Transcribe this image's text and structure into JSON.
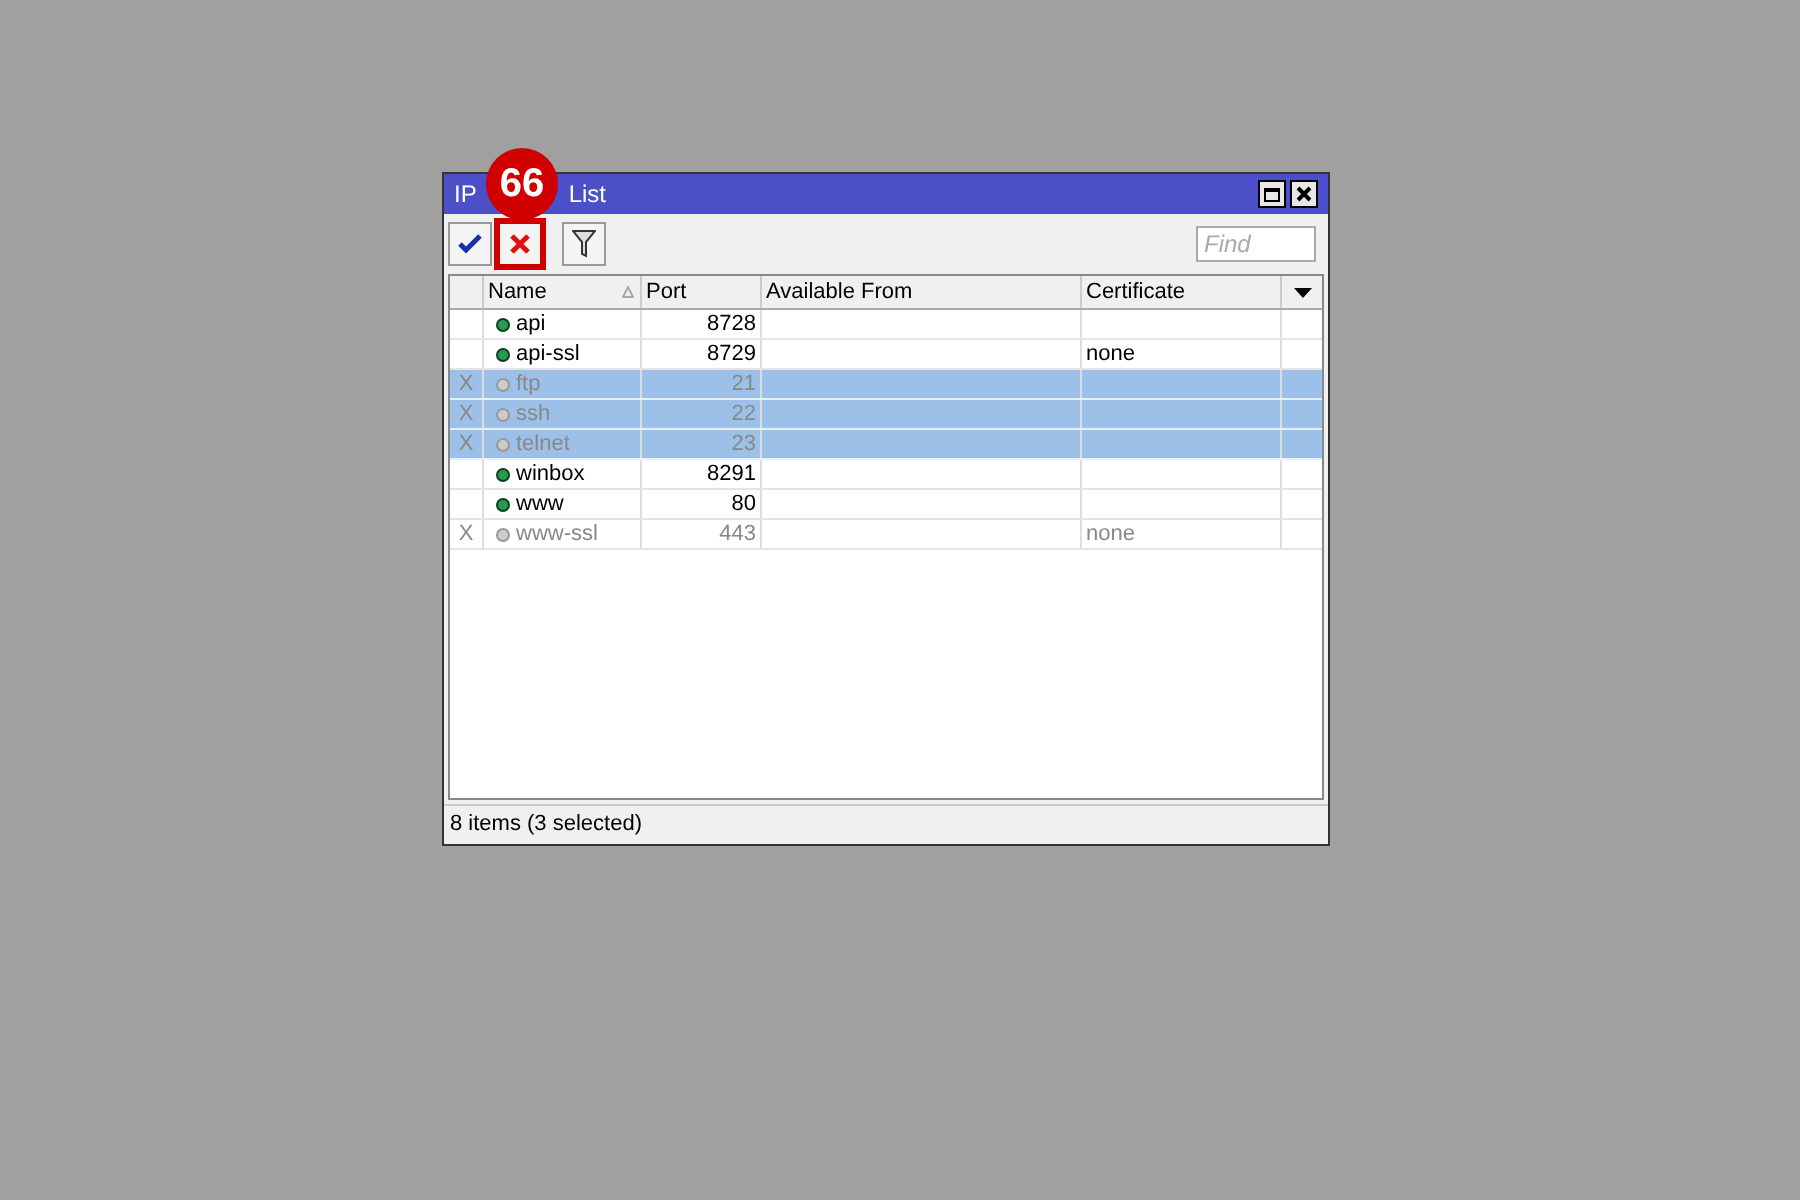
{
  "window": {
    "title_start": "IP",
    "title_end": "List"
  },
  "badge": {
    "text": "66"
  },
  "toolbar": {
    "buttons": [
      {
        "kind": "enable",
        "highlighted": false
      },
      {
        "kind": "disable",
        "highlighted": true
      },
      {
        "kind": "filter",
        "highlighted": false
      }
    ],
    "search": {
      "placeholder": "Find"
    }
  },
  "table": {
    "columns": [
      "Name",
      "Port",
      "Available From",
      "Certificate"
    ],
    "rows": [
      {
        "flag": "",
        "name": "api",
        "port": "8728",
        "available_from": "",
        "certificate": "",
        "disabled": false,
        "selected": false
      },
      {
        "flag": "",
        "name": "api-ssl",
        "port": "8729",
        "available_from": "",
        "certificate": "none",
        "disabled": false,
        "selected": false
      },
      {
        "flag": "X",
        "name": "ftp",
        "port": "21",
        "available_from": "",
        "certificate": "",
        "disabled": true,
        "selected": true
      },
      {
        "flag": "X",
        "name": "ssh",
        "port": "22",
        "available_from": "",
        "certificate": "",
        "disabled": true,
        "selected": true
      },
      {
        "flag": "X",
        "name": "telnet",
        "port": "23",
        "available_from": "",
        "certificate": "",
        "disabled": true,
        "selected": true
      },
      {
        "flag": "",
        "name": "winbox",
        "port": "8291",
        "available_from": "",
        "certificate": "",
        "disabled": false,
        "selected": false
      },
      {
        "flag": "",
        "name": "www",
        "port": "80",
        "available_from": "",
        "certificate": "",
        "disabled": false,
        "selected": false
      },
      {
        "flag": "X",
        "name": "www-ssl",
        "port": "443",
        "available_from": "",
        "certificate": "none",
        "disabled": true,
        "selected": false
      }
    ]
  },
  "status_bar": "8 items (3 selected)"
}
